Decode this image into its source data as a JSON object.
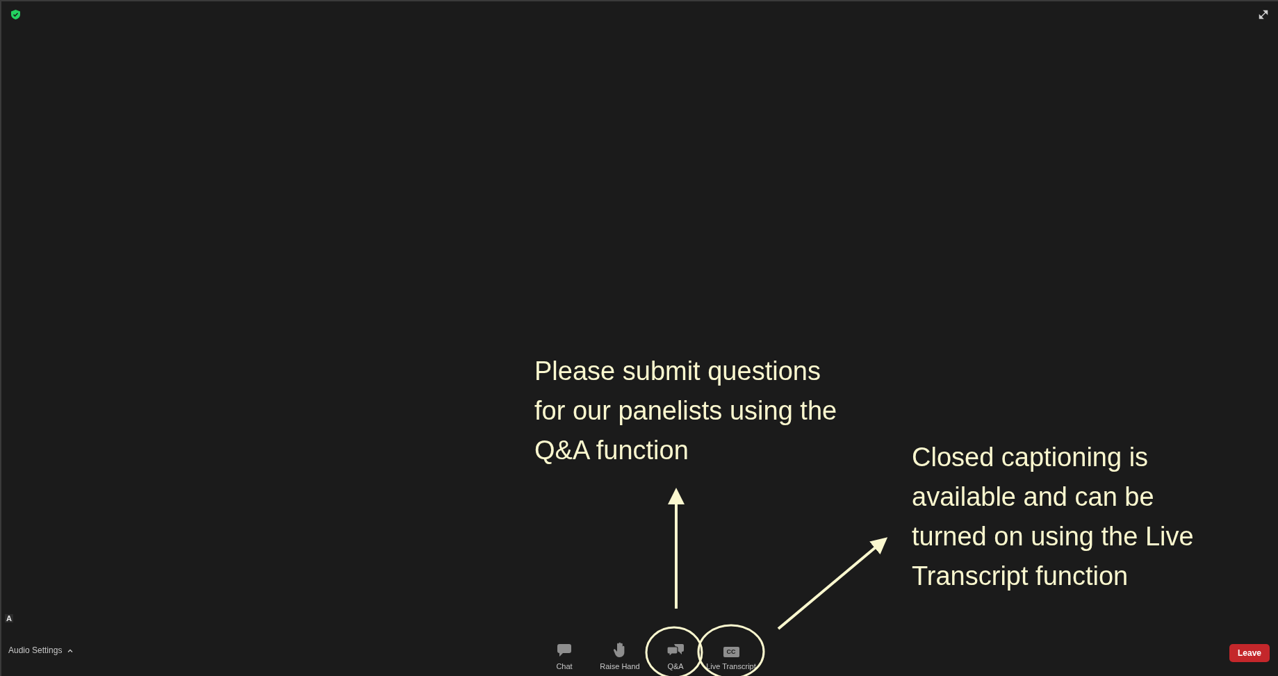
{
  "participant_label": "A",
  "audio_settings": {
    "label": "Audio Settings"
  },
  "toolbar": [
    {
      "kind": "chat",
      "label": "Chat"
    },
    {
      "kind": "hand",
      "label": "Raise Hand"
    },
    {
      "kind": "qa",
      "label": "Q&A"
    },
    {
      "kind": "cc",
      "label": "Live Transcript",
      "icon_text": "CC"
    }
  ],
  "leave_button": {
    "label": "Leave"
  },
  "annotations": [
    {
      "kind": "qa",
      "text": "Please submit questions for our panelists using the Q&A function"
    },
    {
      "kind": "captions",
      "text": "Closed captioning is available and can be turned on using the Live Transcript function"
    }
  ]
}
